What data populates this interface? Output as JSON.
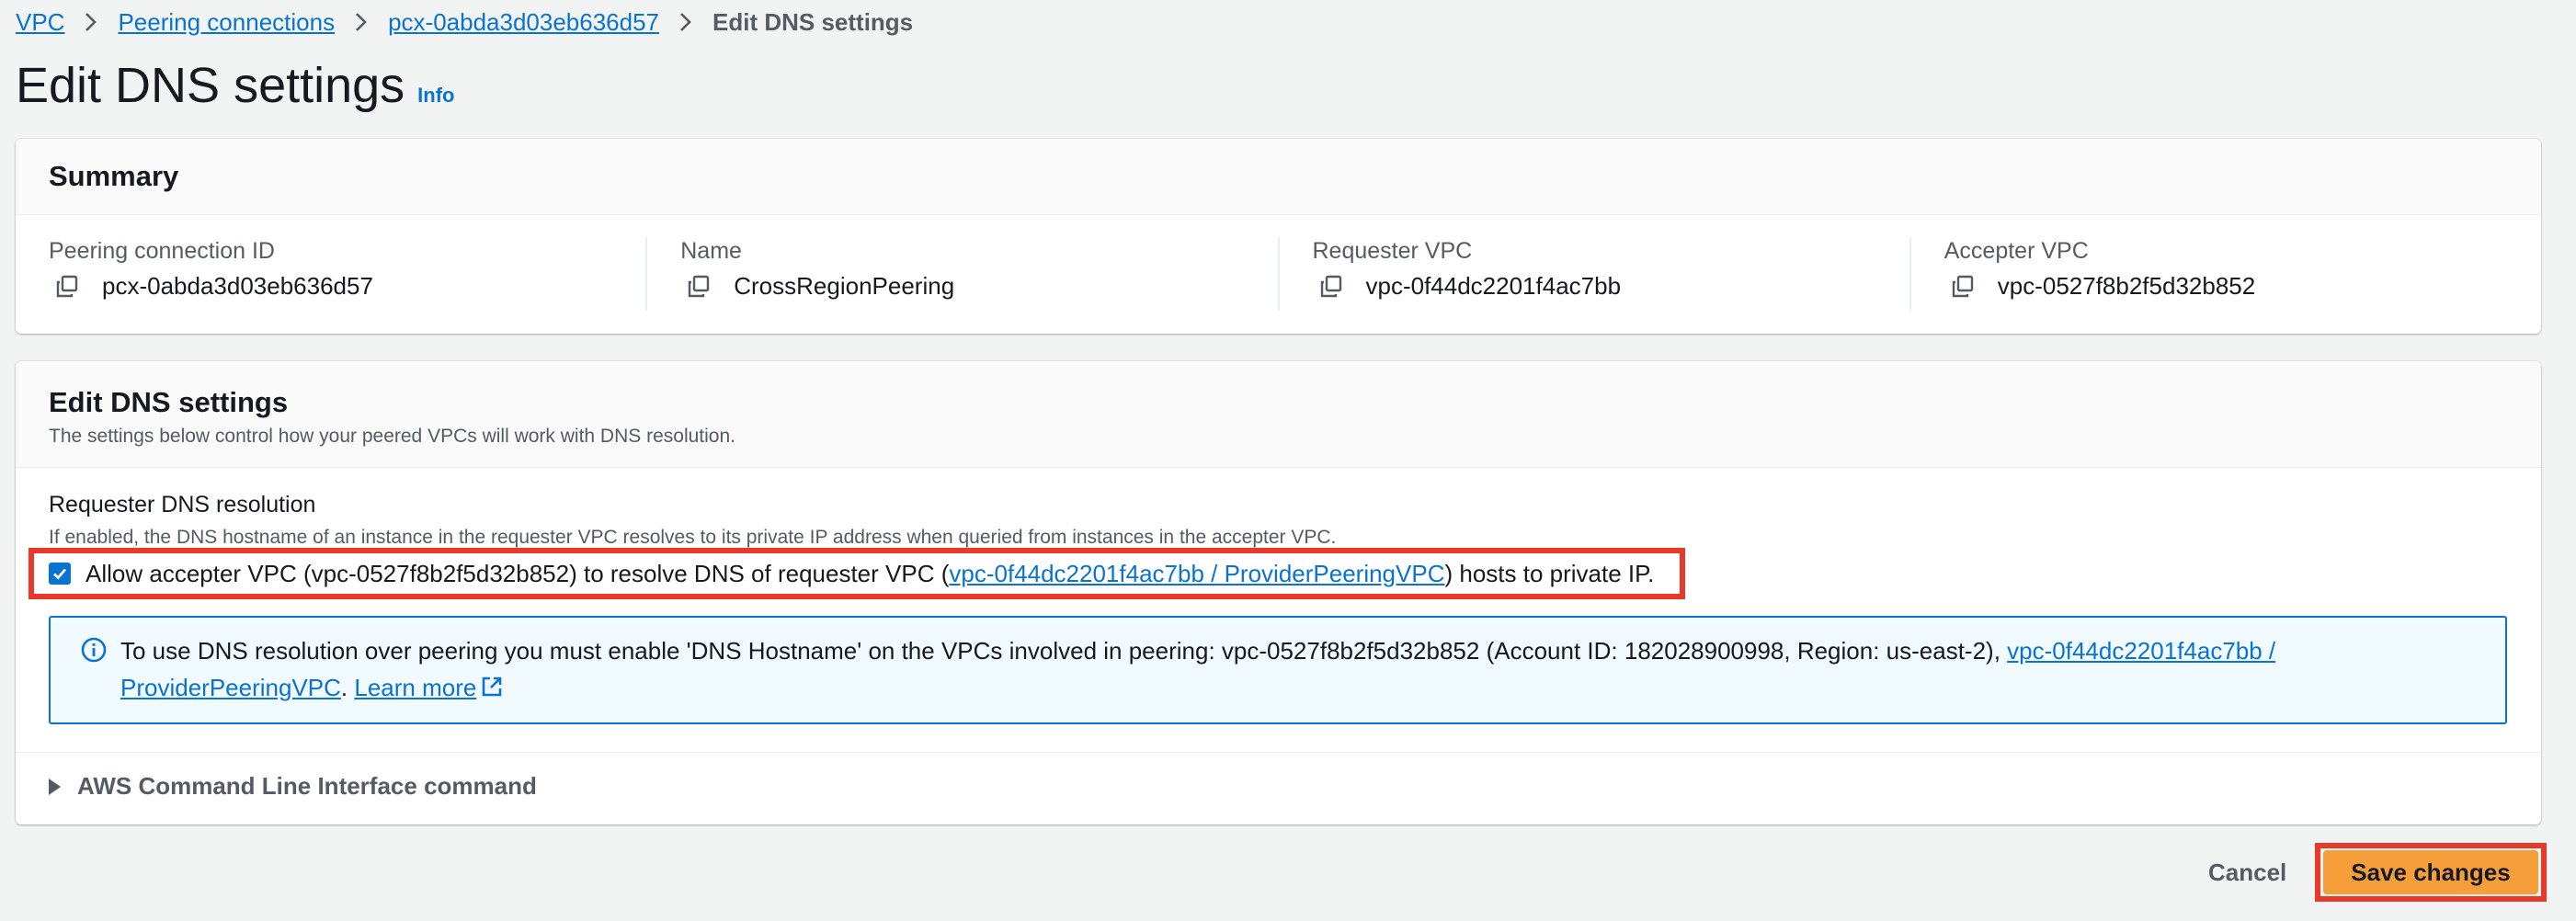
{
  "breadcrumb": {
    "items": [
      {
        "label": "VPC"
      },
      {
        "label": "Peering connections"
      },
      {
        "label": "pcx-0abda3d03eb636d57"
      }
    ],
    "current": "Edit DNS settings"
  },
  "page": {
    "title": "Edit DNS settings",
    "info_label": "Info"
  },
  "summary": {
    "title": "Summary",
    "fields": [
      {
        "label": "Peering connection ID",
        "value": "pcx-0abda3d03eb636d57"
      },
      {
        "label": "Name",
        "value": "CrossRegionPeering"
      },
      {
        "label": "Requester VPC",
        "value": "vpc-0f44dc2201f4ac7bb"
      },
      {
        "label": "Accepter VPC",
        "value": "vpc-0527f8b2f5d32b852"
      }
    ]
  },
  "dns_settings": {
    "title": "Edit DNS settings",
    "description": "The settings below control how your peered VPCs will work with DNS resolution.",
    "requester_resolution": {
      "label": "Requester DNS resolution",
      "description": "If enabled, the DNS hostname of an instance in the requester VPC resolves to its private IP address when queried from instances in the accepter VPC.",
      "checkbox_checked": true,
      "checkbox_text_before": "Allow accepter VPC (vpc-0527f8b2f5d32b852) to resolve DNS of requester VPC (",
      "checkbox_link": "vpc-0f44dc2201f4ac7bb / ProviderPeeringVPC",
      "checkbox_text_after": ") hosts to private IP."
    },
    "info_alert": {
      "text": "To use DNS resolution over peering you must enable 'DNS Hostname' on the VPCs involved in peering: vpc-0527f8b2f5d32b852 (Account ID: 182028900998, Region: us-east-2), ",
      "link": "vpc-0f44dc2201f4ac7bb / ProviderPeeringVPC",
      "after_link": ".",
      "learn_more": "Learn more"
    },
    "cli_expander_label": "AWS Command Line Interface command"
  },
  "footer": {
    "cancel_label": "Cancel",
    "save_label": "Save changes"
  },
  "colors": {
    "link": "#0972d3",
    "primary_button": "#f59e3a",
    "highlight_border": "#e8392b",
    "alert_bg": "#f1faff",
    "page_bg": "#f2f3f3"
  },
  "icons": {
    "copy": "copy-icon",
    "info": "info-circle-icon",
    "external": "external-link-icon",
    "separator": "chevron-right-icon",
    "expander": "caret-right-icon"
  }
}
